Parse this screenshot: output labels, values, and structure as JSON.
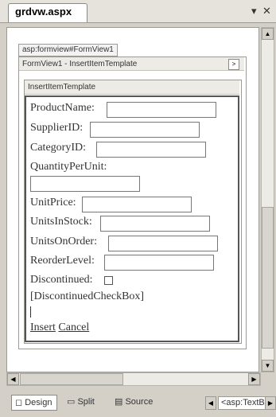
{
  "tabs": {
    "doc_title": "grdvw.aspx",
    "menu_glyph": "▾",
    "close_glyph": "✕"
  },
  "form_view": {
    "tag": "asp:formview#FormView1",
    "header": "FormView1 - InsertItemTemplate",
    "smart_tag": ">",
    "template_name": "InsertItemTemplate"
  },
  "fields": [
    {
      "label": "ProductName:"
    },
    {
      "label": "SupplierID:"
    },
    {
      "label": "CategoryID:"
    },
    {
      "label": "QuantityPerUnit:"
    },
    {
      "label": "UnitPrice:"
    },
    {
      "label": "UnitsInStock:"
    },
    {
      "label": "UnitsOnOrder:"
    },
    {
      "label": "ReorderLevel:"
    },
    {
      "label": "Discontinued:"
    }
  ],
  "discontinued_checkbox_placeholder": "[DiscontinuedCheckBox]",
  "links": {
    "insert": "Insert",
    "cancel": "Cancel"
  },
  "views": {
    "design": "Design",
    "split": "Split",
    "source": "Source"
  },
  "breadcrumb": "<asp:TextB"
}
